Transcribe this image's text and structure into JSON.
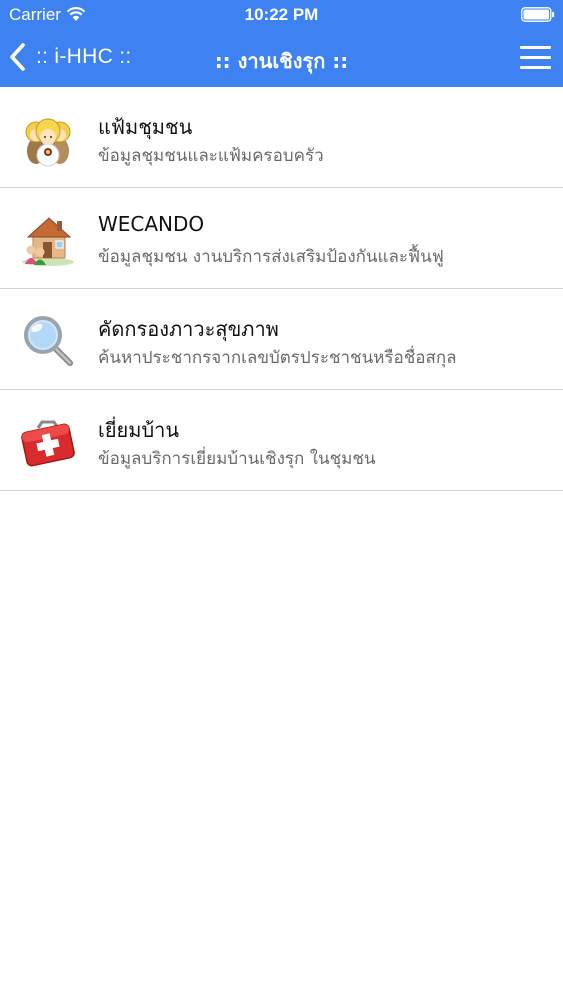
{
  "status_bar": {
    "carrier": "Carrier",
    "time": "10:22 PM"
  },
  "nav": {
    "back_label": ":: i-HHC ::",
    "title": ":: งานเชิงรุก ::",
    "color": "#3d82f0"
  },
  "items": [
    {
      "title": "แฟ้มชุมชน",
      "subtitle": "ข้อมูลชุมชนและแฟ้มครอบครัว",
      "icon": "people-icon"
    },
    {
      "title": "WECANDO",
      "subtitle": "ข้อมูลชุมชน งานบริการส่งเสริมป้องกันและฟื้นฟู",
      "icon": "house-family-icon"
    },
    {
      "title": "คัดกรองภาวะสุขภาพ",
      "subtitle": "ค้นหาประชากรจากเลขบัตรประชาชนหรือชื่อสกุล",
      "icon": "magnifier-icon"
    },
    {
      "title": "เยี่ยมบ้าน",
      "subtitle": "ข้อมูลบริการเยี่ยมบ้านเชิงรุก ในชุมชน",
      "icon": "first-aid-kit-icon"
    }
  ]
}
